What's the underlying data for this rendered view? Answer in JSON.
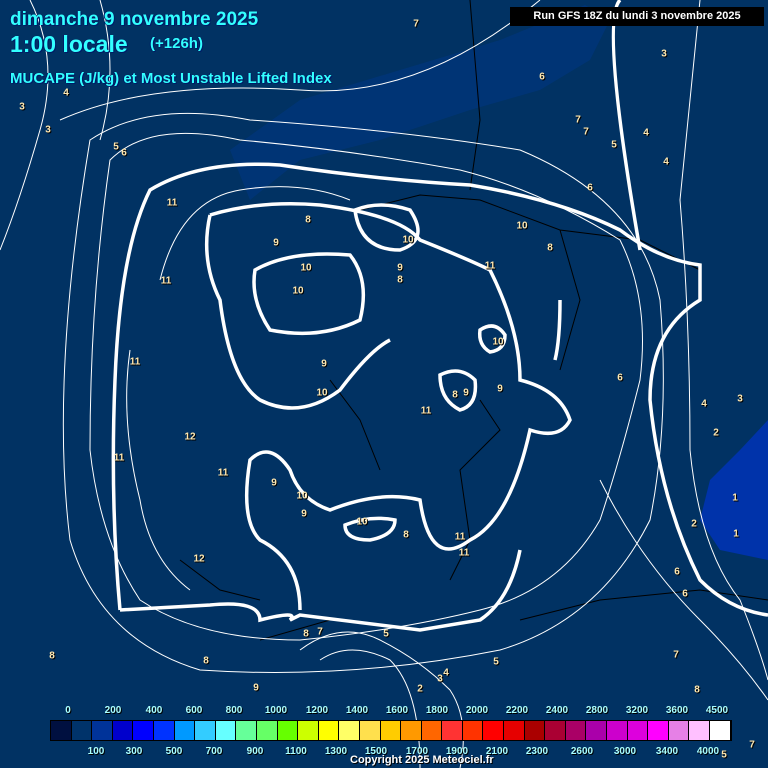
{
  "header": {
    "date": "dimanche 9 novembre 2025",
    "time": "1:00 locale",
    "lead": "(+126h)",
    "parameter": "MUCAPE (J/kg) et Most Unstable Lifted Index",
    "run": "Run GFS 18Z du lundi 3 novembre 2025"
  },
  "legend": {
    "colors": [
      "#001040",
      "#00336a",
      "#003399",
      "#0000cc",
      "#0000ff",
      "#0033ff",
      "#0099ff",
      "#33ccff",
      "#66ffff",
      "#66ff99",
      "#66ff66",
      "#66ff00",
      "#ccff00",
      "#ffff00",
      "#ffff66",
      "#ffe04d",
      "#ffcc00",
      "#ff9900",
      "#ff6600",
      "#ff3333",
      "#ff3300",
      "#ff0000",
      "#e60000",
      "#aa0000",
      "#aa0033",
      "#aa0066",
      "#aa00aa",
      "#cc00cc",
      "#dd00dd",
      "#ff00ff",
      "#e680e6",
      "#ffc0ff",
      "#ffffff"
    ],
    "top_labels": [
      "0",
      "200",
      "400",
      "600",
      "800",
      "1000",
      "1200",
      "1400",
      "1600",
      "1800",
      "2000",
      "2200",
      "2400",
      "2800",
      "3200",
      "3600",
      "4500"
    ],
    "bottom_labels": [
      "100",
      "300",
      "500",
      "700",
      "900",
      "1100",
      "1300",
      "1500",
      "1700",
      "1900",
      "2100",
      "2300",
      "2600",
      "3000",
      "3400",
      "4000"
    ]
  },
  "contour_labels": [
    "7",
    "3",
    "6",
    "4",
    "3",
    "3",
    "5",
    "6",
    "7",
    "7",
    "5",
    "4",
    "4",
    "6",
    "11",
    "8",
    "9",
    "10",
    "10",
    "10",
    "9",
    "8",
    "10",
    "8",
    "11",
    "11",
    "10",
    "9",
    "9",
    "10",
    "8",
    "9",
    "11",
    "11",
    "12",
    "11",
    "11",
    "9",
    "10",
    "9",
    "10",
    "8",
    "11",
    "11",
    "12",
    "6",
    "4",
    "3",
    "2",
    "1",
    "1",
    "2",
    "6",
    "6",
    "8",
    "7",
    "5",
    "5",
    "7",
    "3",
    "4",
    "2",
    "9",
    "8",
    "8",
    "8",
    "7",
    "5"
  ],
  "copyright": "Copyright 2025 Meteociel.fr"
}
